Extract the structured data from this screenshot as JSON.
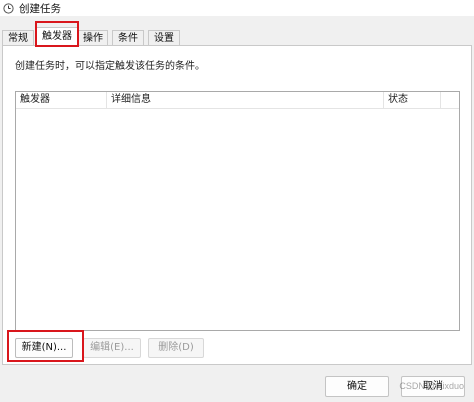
{
  "window": {
    "title": "创建任务",
    "icon": "clock-icon"
  },
  "tabs": [
    {
      "label": "常规",
      "active": false
    },
    {
      "label": "触发器",
      "active": true
    },
    {
      "label": "操作",
      "active": false
    },
    {
      "label": "条件",
      "active": false
    },
    {
      "label": "设置",
      "active": false
    }
  ],
  "triggers_page": {
    "description": "创建任务时，可以指定触发该任务的条件。",
    "columns": [
      "触发器",
      "详细信息",
      "状态"
    ],
    "rows": [],
    "buttons": {
      "new": "新建(N)...",
      "edit": "编辑(E)...",
      "delete": "删除(D)"
    }
  },
  "footer": {
    "ok": "确定",
    "cancel": "取消"
  },
  "watermark": "CSDN @Aixduo",
  "colors": {
    "highlight": "#d9161c",
    "panel_background": "#ffffff",
    "window_background": "#f0f0f0"
  }
}
